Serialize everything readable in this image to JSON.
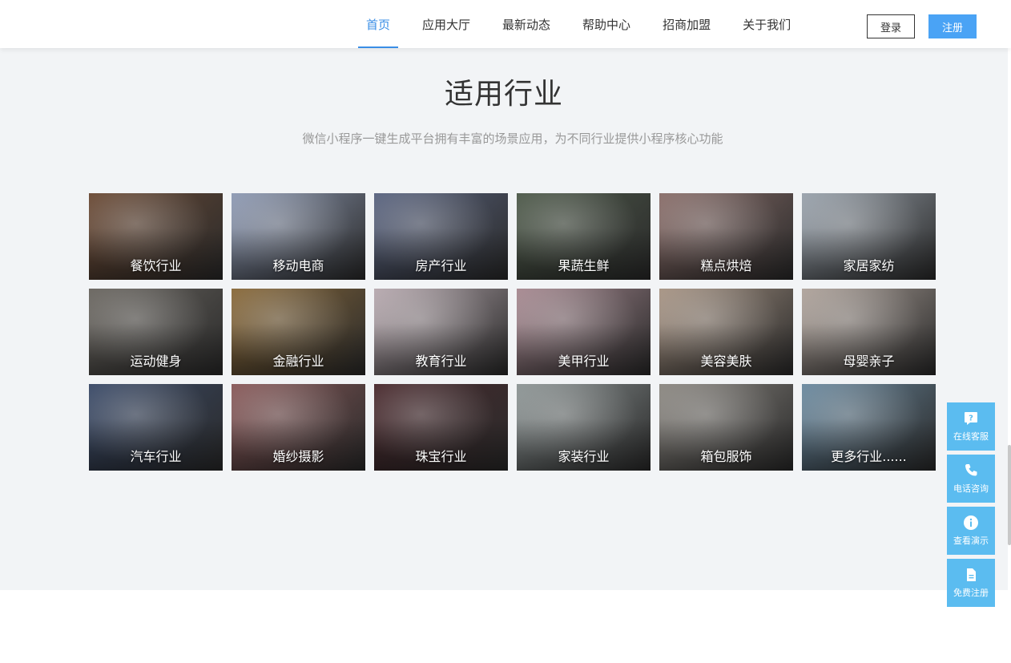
{
  "nav": {
    "items": [
      {
        "label": "首页",
        "active": true
      },
      {
        "label": "应用大厅",
        "active": false
      },
      {
        "label": "最新动态",
        "active": false
      },
      {
        "label": "帮助中心",
        "active": false
      },
      {
        "label": "招商加盟",
        "active": false
      },
      {
        "label": "关于我们",
        "active": false
      }
    ],
    "login_label": "登录",
    "register_label": "注册"
  },
  "section": {
    "title": "适用行业",
    "subtitle": "微信小程序一键生成平台拥有丰富的场景应用，为不同行业提供小程序核心功能"
  },
  "industries": [
    {
      "label": "餐饮行业",
      "color": "#6b4a35"
    },
    {
      "label": "移动电商",
      "color": "#8f9bb5"
    },
    {
      "label": "房产行业",
      "color": "#5a6480"
    },
    {
      "label": "果蔬生鲜",
      "color": "#4e5a4a"
    },
    {
      "label": "糕点烘焙",
      "color": "#8a6e6a"
    },
    {
      "label": "家居家纺",
      "color": "#9aa3ad"
    },
    {
      "label": "运动健身",
      "color": "#6a6660"
    },
    {
      "label": "金融行业",
      "color": "#8a6a3a"
    },
    {
      "label": "教育行业",
      "color": "#b8aab0"
    },
    {
      "label": "美甲行业",
      "color": "#a88a92"
    },
    {
      "label": "美容美肤",
      "color": "#a89585"
    },
    {
      "label": "母婴亲子",
      "color": "#b0a49c"
    },
    {
      "label": "汽车行业",
      "color": "#3a4a68"
    },
    {
      "label": "婚纱摄影",
      "color": "#8a5a5a"
    },
    {
      "label": "珠宝行业",
      "color": "#4a2a2e"
    },
    {
      "label": "家装行业",
      "color": "#8e9696"
    },
    {
      "label": "箱包服饰",
      "color": "#8c8882"
    },
    {
      "label": "更多行业......",
      "color": "#6b8aa0"
    }
  ],
  "float_bar": [
    {
      "label": "在线客服",
      "icon": "question-icon"
    },
    {
      "label": "电话咨询",
      "icon": "phone-icon"
    },
    {
      "label": "查看演示",
      "icon": "info-icon"
    },
    {
      "label": "免费注册",
      "icon": "document-icon"
    }
  ]
}
